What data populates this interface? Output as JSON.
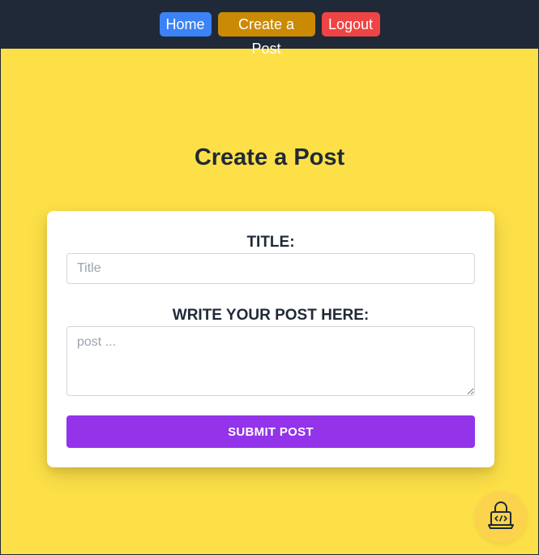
{
  "nav": {
    "home_label": "Home",
    "create_label": "Create a Post",
    "logout_label": "Logout"
  },
  "page": {
    "title": "Create a Post"
  },
  "form": {
    "title_label": "TITLE:",
    "title_placeholder": "Title",
    "title_value": "",
    "post_label": "WRITE YOUR POST HERE:",
    "post_placeholder": "post ...",
    "post_value": "",
    "submit_label": "SUBMIT POST"
  },
  "widget": {
    "icon": "laptop-lock-code-icon"
  },
  "colors": {
    "page_background": "#fde047",
    "navbar_background": "#1f2937",
    "home_button": "#3b82f6",
    "create_button": "#ca8a04",
    "logout_button": "#ef4444",
    "submit_button": "#9333ea"
  }
}
